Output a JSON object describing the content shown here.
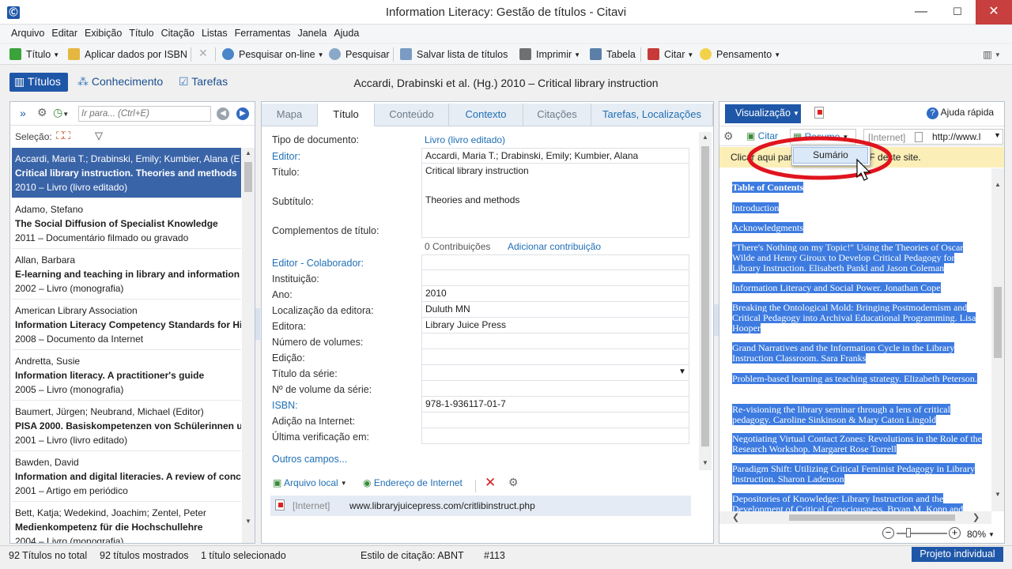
{
  "window": {
    "title": "Information Literacy: Gestão de títulos - Citavi",
    "app_icon": "Ⓒ",
    "minimize": "—",
    "maximize": "☐",
    "close": "✕"
  },
  "menu": [
    "Arquivo",
    "Editar",
    "Exibição",
    "Título",
    "Citação",
    "Listas",
    "Ferramentas",
    "Janela",
    "Ajuda"
  ],
  "toolbar": {
    "title_btn": "Título",
    "isbn": "Aplicar dados por ISBN",
    "search_online": "Pesquisar on-line",
    "search": "Pesquisar",
    "save_list": "Salvar lista de títulos",
    "print": "Imprimir",
    "table": "Tabela",
    "cite": "Citar",
    "thought": "Pensamento"
  },
  "nav": {
    "titles": "Títulos",
    "knowledge": "Conhecimento",
    "tasks": "Tarefas"
  },
  "reference_header": "Accardi, Drabinski et al. (Hg.) 2010 – Critical library instruction",
  "left": {
    "goto_placeholder": "Ir para... (Ctrl+E)",
    "selection_label": "Seleção:",
    "items": [
      {
        "authors": "Accardi, Maria T.; Drabinski, Emily; Kumbier, Alana (E",
        "title": "Critical library instruction. Theories and methods",
        "meta": "2010 – Livro (livro editado)"
      },
      {
        "authors": "Adamo, Stefano",
        "title": "The Social Diffusion of Specialist Knowledge",
        "meta": "2011 – Documentário filmado ou gravado"
      },
      {
        "authors": "Allan, Barbara",
        "title": "E-learning and teaching in library and information s",
        "meta": "2002 – Livro (monografia)"
      },
      {
        "authors": "American Library Association",
        "title": "Information Literacy Competency Standards for Hi",
        "meta": "2008 – Documento da Internet"
      },
      {
        "authors": "Andretta, Susie",
        "title": "Information literacy. A practitioner's guide",
        "meta": "2005 – Livro (monografia)"
      },
      {
        "authors": "Baumert, Jürgen; Neubrand, Michael (Editor)",
        "title": "PISA 2000. Basiskompetenzen von Schülerinnen un",
        "meta": "2001 – Livro (livro editado)"
      },
      {
        "authors": "Bawden, David",
        "title": "Information and digital literacies. A review of conc",
        "meta": "2001 – Artigo em periódico"
      },
      {
        "authors": "Bett, Katja; Wedekind, Joachim; Zentel, Peter",
        "title": "Medienkompetenz für die Hochschullehre",
        "meta": "2004 – Livro (monografia)"
      }
    ]
  },
  "mid": {
    "tabs": [
      "Mapa",
      "Título",
      "Conteúdo",
      "Contexto",
      "Citações",
      "Tarefas, Localizações"
    ],
    "fields": {
      "doc_type_label": "Tipo de documento:",
      "doc_type_value": "Livro (livro editado)",
      "editor_label": "Editor:",
      "editor_value": "Accardi, Maria T.; Drabinski, Emily; Kumbier, Alana",
      "title_label": "Título:",
      "title_value": "Critical library instruction",
      "subtitle_label": "Subtítulo:",
      "subtitle_value": "Theories and methods",
      "complements_label": "Complementos de título:",
      "contributions": "0 Contribuições",
      "add_contribution": "Adicionar contribuição",
      "coeditor_label": "Editor - Colaborador:",
      "institution_label": "Instituição:",
      "year_label": "Ano:",
      "year_value": "2010",
      "place_label": "Localização da editora:",
      "place_value": "Duluth MN",
      "publisher_label": "Editora:",
      "publisher_value": "Library Juice Press",
      "volumes_label": "Número de volumes:",
      "edition_label": "Edição:",
      "series_label": "Título da série:",
      "series_vol_label": "Nº de volume da série:",
      "isbn_label": "ISBN:",
      "isbn_value": "978-1-936117-01-7",
      "web_added_label": "Adição na Internet:",
      "last_checked_label": "Última verificação em:",
      "other_fields": "Outros campos..."
    },
    "attach": {
      "local_file": "Arquivo local",
      "web_address": "Endereço de Internet",
      "row_tag": "[Internet]",
      "row_url": "www.libraryjuicepress.com/critlibinstruct.php"
    }
  },
  "right": {
    "view_btn": "Visualização",
    "help": "Ajuda rápida",
    "cite": "Citar",
    "summary": "Resumo",
    "internet_tag": "[Internet]",
    "url": "http://www.l",
    "banner": "Clicar aqui par          local em PDF deste site.",
    "popup_item": "Sumário",
    "zoom": "80%",
    "toc": [
      "Table of Contents",
      "Introduction",
      "Acknowledgments",
      "\"There's Nothing on my Topic!\" Using the Theories of Oscar Wilde and Henry Giroux to Develop Critical Pedagogy for Library Instruction. Elisabeth Pankl and Jason Coleman",
      "Information Literacy and Social Power. Jonathan Cope",
      "Breaking the Ontological Mold: Bringing Postmodernism and Critical Pedagogy into Archival Educational Programming. Lisa Hooper",
      "Grand Narratives and the Information Cycle in the Library Instruction Classroom. Sara Franks",
      "Problem-based learning as teaching strategy. Elizabeth Peterson.",
      "Re-visioning the library seminar through a lens of critical pedagogy. Caroline Sinkinson & Mary Caton Lingold",
      "Negotiating Virtual Contact Zones: Revolutions in the Role of the Research Workshop. Margaret Rose Torrell",
      "Paradigm Shift: Utilizing Critical Feminist Pedagogy in Library Instruction. Sharon Ladenson",
      "Depositories of Knowledge: Library Instruction and the Development of Critical Consciousness. Bryan M. Kopp and"
    ]
  },
  "status": {
    "total": "92 Títulos no total",
    "shown": "92 títulos mostrados",
    "selected": "1 título selecionado",
    "style": "Estilo de citação: ABNT",
    "num": "#113",
    "project": "Projeto individual"
  },
  "colors": {
    "accent": "#1f57a8",
    "highlight": "#3d7be0",
    "close": "#c73f3f",
    "annotation": "#e0141e"
  }
}
